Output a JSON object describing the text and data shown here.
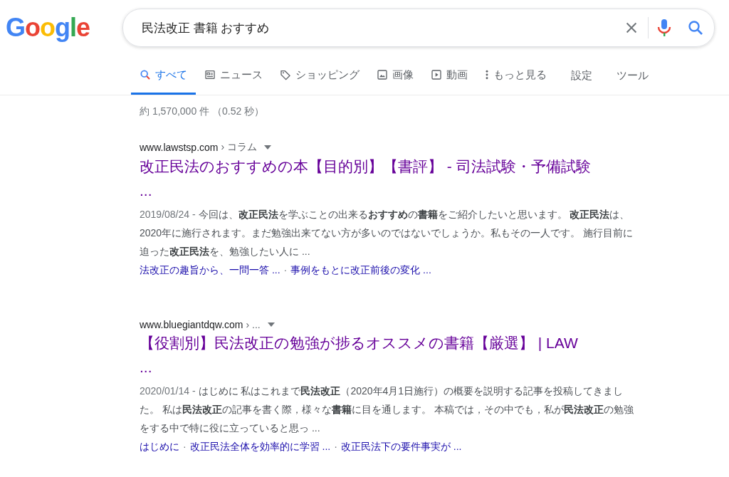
{
  "logo": "Google",
  "search": {
    "value": "民法改正 書籍 おすすめ"
  },
  "tabs": [
    {
      "label": "すべて",
      "kind": "search",
      "selected": true
    },
    {
      "label": "ニュース",
      "kind": "news",
      "selected": false
    },
    {
      "label": "ショッピング",
      "kind": "tag",
      "selected": false
    },
    {
      "label": "画像",
      "kind": "image",
      "selected": false
    },
    {
      "label": "動画",
      "kind": "play",
      "selected": false
    },
    {
      "label": "もっと見る",
      "kind": "more",
      "selected": false
    }
  ],
  "tools": [
    "設定",
    "ツール"
  ],
  "stats": "約 1,570,000 件 （0.52 秒）",
  "results": [
    {
      "site": "www.lawstsp.com",
      "breadcrumb": "› コラム",
      "title": "改正民法のおすすめの本【目的別】【書評】 - 司法試験・予備試験",
      "title_end": "...",
      "date": "2019/08/24 -",
      "snippet": "今回は、**改正民法**を学ぶことの出来る**おすすめ**の**書籍**をご紹介したいと思います。 **改正民法**は、2020年に施行されます。まだ勉強出来てない方が多いのではないでしょうか。私もその一人です。 施行目前に迫った**改正民法**を、勉強したい人に ...",
      "links": [
        "法改正の趣旨から、一問一答 ...",
        "事例をもとに改正前後の変化 ..."
      ],
      "separator": "·"
    },
    {
      "site": "www.bluegiantdqw.com",
      "breadcrumb": "› ...",
      "title": "【役割別】民法改正の勉強が捗るオススメの書籍【厳選】 | LAW",
      "title_end": "...",
      "date": "2020/01/14 -",
      "snippet": "はじめに 私はこれまで**民法改正**（2020年4月1日施行）の概要を説明する記事を投稿してきました。 私は**民法改正**の記事を書く際，様々な**書籍**に目を通します。 本稿では，その中でも，私が**民法改正**の勉強をする中で特に役に立っていると思っ ...",
      "links": [
        "はじめに",
        "改正民法全体を効率的に学習 ...",
        "改正民法下の要件事実が ..."
      ],
      "separator": "·"
    }
  ]
}
